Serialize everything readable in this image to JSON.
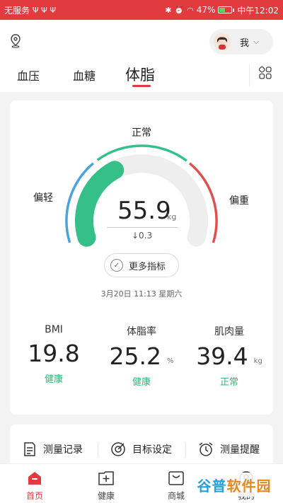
{
  "status_bar": {
    "carrier": "无服务",
    "battery": "47%",
    "time": "中午12:02"
  },
  "header": {
    "me_label": "我",
    "tabs": [
      {
        "label": "血压"
      },
      {
        "label": "血糖"
      },
      {
        "label": "体脂"
      }
    ],
    "active_tab": "体脂"
  },
  "gauge": {
    "label_normal": "正常",
    "label_light": "偏轻",
    "label_heavy": "偏重",
    "value": "55.9",
    "unit": "kg",
    "delta": "↓0.3",
    "progress": 0.37,
    "colors": {
      "light": "#4aa3e0",
      "normal": "#35c08a",
      "heavy": "#e05050",
      "track": "#eeeeee"
    }
  },
  "more_button": {
    "label": "更多指标"
  },
  "date": "3月20日 11:13 星期六",
  "metrics": [
    {
      "title": "BMI",
      "value": "19.8",
      "unit": "",
      "status": "健康"
    },
    {
      "title": "体脂率",
      "value": "25.2",
      "unit": "%",
      "status": "健康"
    },
    {
      "title": "肌肉量",
      "value": "39.4",
      "unit": "kg",
      "status": "正常"
    }
  ],
  "quick_actions": [
    {
      "label": "测量记录",
      "icon": "record-icon"
    },
    {
      "label": "目标设定",
      "icon": "target-icon"
    },
    {
      "label": "测量提醒",
      "icon": "alarm-icon"
    }
  ],
  "bottom_nav": [
    {
      "label": "首页",
      "icon": "home-icon"
    },
    {
      "label": "健康",
      "icon": "health-icon"
    },
    {
      "label": "商城",
      "icon": "shop-icon"
    },
    {
      "label": "我的",
      "icon": "profile-icon"
    }
  ],
  "watermark": "谷普软件园"
}
